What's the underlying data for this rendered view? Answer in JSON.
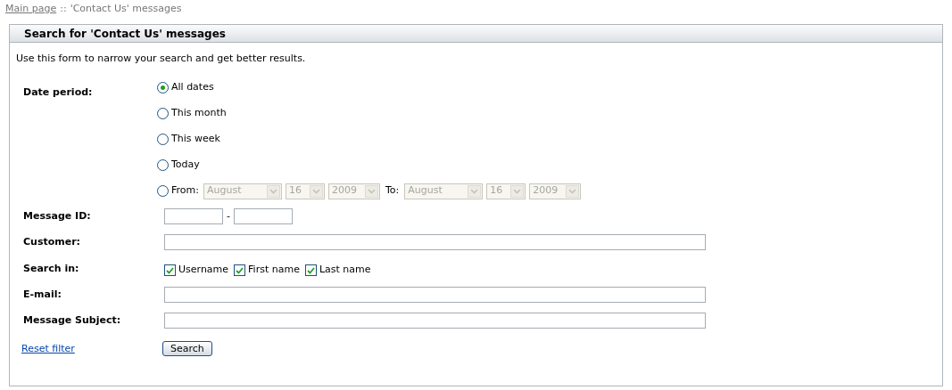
{
  "breadcrumb": {
    "link": "Main page",
    "separator": "::",
    "current": "'Contact Us' messages"
  },
  "panel": {
    "title": "Search for 'Contact Us' messages",
    "intro": "Use this form to narrow your search and get better results."
  },
  "date_period": {
    "label": "Date period:",
    "options": [
      {
        "kind": "plain",
        "label": "All dates",
        "selected": true
      },
      {
        "kind": "plain",
        "label": "This month",
        "selected": false
      },
      {
        "kind": "plain",
        "label": "This week",
        "selected": false
      },
      {
        "kind": "plain",
        "label": "Today",
        "selected": false
      },
      {
        "kind": "range",
        "label": "From:",
        "selected": false,
        "from": [
          "August",
          "16",
          "2009"
        ],
        "to_label": "To:",
        "to": [
          "August",
          "16",
          "2009"
        ]
      }
    ]
  },
  "message_id": {
    "label": "Message ID:",
    "separator": "-"
  },
  "customer": {
    "label": "Customer:"
  },
  "search_in": {
    "label": "Search in:",
    "options": [
      {
        "label": "Username",
        "checked": true
      },
      {
        "label": "First name",
        "checked": true
      },
      {
        "label": "Last name",
        "checked": true
      }
    ]
  },
  "email": {
    "label": "E-mail:"
  },
  "subject": {
    "label": "Message Subject:"
  },
  "reset_link": "Reset filter",
  "search_button": "Search"
}
